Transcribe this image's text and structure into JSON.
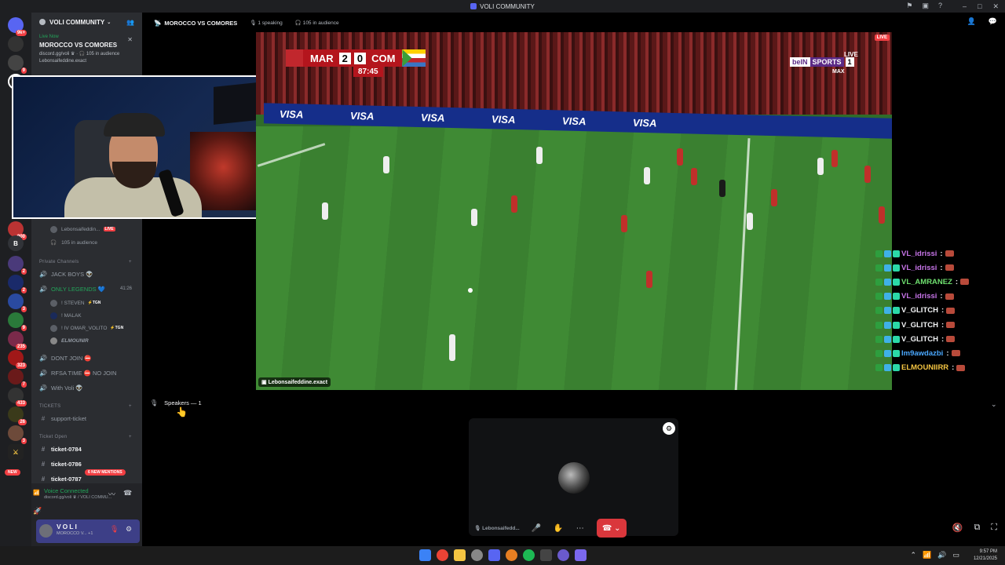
{
  "window": {
    "title": "VOLI COMMUNITY"
  },
  "server_rail": {
    "badges": [
      "9k+",
      "9",
      "",
      "",
      "",
      "",
      "",
      "",
      "",
      "",
      "",
      "900",
      "B",
      "2",
      "2",
      "3",
      "9",
      "235",
      "323",
      "7",
      "433",
      "26",
      "3",
      "NEW"
    ]
  },
  "guild": {
    "name": "VOLI COMMUNITY",
    "live_card": {
      "status": "Live Now",
      "title": "MOROCCO VS COMORES",
      "subtitle": "discord.gg/voli ♛ · 🎧 105 in audience",
      "host": "Lebonsaifeddine.exact"
    },
    "stage_member": "Lebonsaifeddin...",
    "audience": "105 in audience",
    "categories": {
      "private": "Private Channels",
      "tickets": "TICKETS",
      "ticket_open": "Ticket Open"
    },
    "channels": {
      "jack_boys": "JACK BOYS 👽",
      "only_legends": "ONLY LEGENDS 💙",
      "only_legends_timer": "41:26",
      "dont_join": "DONT JOIN ⛔",
      "rfsa_time": "RFSA TIME ⛔ NO JOIN",
      "with_voli": "With Voli 👽",
      "support_ticket": "support-ticket",
      "ticket_0784": "ticket-0784",
      "ticket_0786": "ticket-0786",
      "ticket_0787": "ticket-0787"
    },
    "legends_members": [
      {
        "name": "! STEVEN",
        "tag": "⚡TGN"
      },
      {
        "name": "! MALAK",
        "tag": ""
      },
      {
        "name": "! IV OMAR_VOLITO",
        "tag": "⚡TGN"
      },
      {
        "name": "ELMOUNIR",
        "tag": ""
      }
    ],
    "new_mentions": "6 NEW MENTIONS",
    "new_label": "NEW"
  },
  "voice": {
    "status": "Voice Connected",
    "location": "discord.gg/voli ♛ / VOLI COMMU..."
  },
  "user": {
    "name": "VOLI",
    "status": "MOROCCO V...",
    "plus": "+1"
  },
  "stage": {
    "title": "MOROCCO VS COMORES",
    "speaking": "1 speaking",
    "audience": "105 in audience",
    "live": "LIVE",
    "streamer_tag": "Lebonsaifeddine.exact",
    "speakers_label": "Speakers — 1",
    "speaker_name": "Lebonsaifedd..."
  },
  "broadcast": {
    "home": "MAR",
    "home_score": "2",
    "away_score": "0",
    "away": "COM",
    "clock": "87:45",
    "network_1": "beIN",
    "network_2": "SPORTS",
    "network_3": "1",
    "network_live": "LIVE",
    "network_max": "MAX",
    "sponsor": "VISA"
  },
  "chat": [
    {
      "user": "VL_idrissi",
      "color": "#c774e8",
      "sep": ":"
    },
    {
      "user": "VL_idrissi",
      "color": "#c774e8",
      "sep": ":"
    },
    {
      "user": "VL_AMRANEZ",
      "color": "#6fe06f",
      "sep": ":"
    },
    {
      "user": "VL_idrissi",
      "color": "#c774e8",
      "sep": ":"
    },
    {
      "user": "V_GLITCH",
      "color": "#f2f3f5",
      "sep": ":"
    },
    {
      "user": "V_GLITCH",
      "color": "#f2f3f5",
      "sep": ":"
    },
    {
      "user": "V_GLITCH",
      "color": "#f2f3f5",
      "sep": ":"
    },
    {
      "user": "Im9awdazbi",
      "color": "#4aa8ff",
      "sep": ":"
    },
    {
      "user": "ELMOUNIIRR",
      "color": "#f5c542",
      "sep": ":"
    }
  ],
  "taskbar": {
    "time": "9:57 PM",
    "date": "12/21/2025"
  },
  "colors": {
    "live_red": "#f23f43",
    "online_green": "#23a55a",
    "blurple": "#5865f2"
  }
}
